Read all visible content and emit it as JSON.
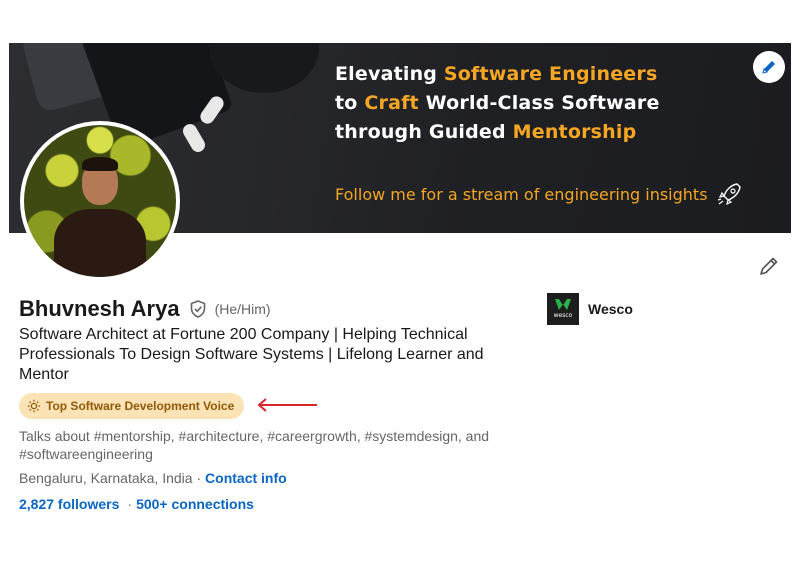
{
  "banner": {
    "line1_a": "Elevating ",
    "line1_b": "Software Engineers",
    "line2_a": "to ",
    "line2_b": "Craft",
    "line2_c": " World-Class Software",
    "line3_a": "through Guided ",
    "line3_b": "Mentorship",
    "tagline": "Follow me for a stream of engineering insights",
    "tagline_icon": "rocket-icon"
  },
  "profile": {
    "name": "Bhuvnesh Arya",
    "pronouns": "(He/Him)",
    "headline": "Software Architect at Fortune 200 Company | Helping Technical Professionals To Design Software Systems | Lifelong Learner and Mentor",
    "badge": "Top Software Development Voice",
    "talks_about": "Talks about #mentorship, #architecture, #careergrowth, #systemdesign, and #softwareengineering",
    "location": "Bengaluru, Karnataka, India",
    "location_sep": " · ",
    "contact_info": "Contact info",
    "followers": "2,827 followers",
    "connections_sep": "·",
    "connections": "500+ connections"
  },
  "company": {
    "name": "Wesco",
    "logo_text": "wesco"
  },
  "colors": {
    "link": "#0a66c2",
    "badge_bg": "#fbe3b6",
    "badge_text": "#915907",
    "banner_accent": "#f5a623",
    "annotation_arrow": "#d9262c"
  }
}
